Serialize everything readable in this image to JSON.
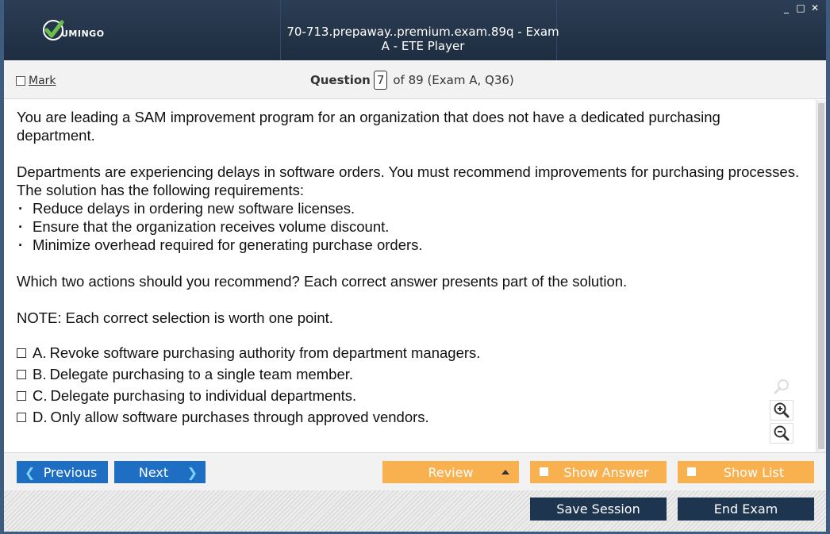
{
  "window": {
    "title": "70-713.prepaway..premium.exam.89q - Exam A - ETE Player",
    "logo_text": "UMINGO",
    "controls": {
      "minimize": "_",
      "maximize": "□",
      "close": "✕"
    }
  },
  "header": {
    "mark_label": "Mark",
    "question_label": "Question",
    "question_number": "7",
    "question_of": "of 89 (Exam A, Q36)"
  },
  "question": {
    "intro": "You are leading a SAM improvement program for an organization that does not have a dedicated purchasing department.",
    "scenario": "Departments are experiencing delays in software orders. You must recommend improvements for purchasing processes. The solution has the following requirements:",
    "requirements": [
      "Reduce delays in ordering new software licenses.",
      "Ensure that the organization receives volume discount.",
      "Minimize overhead required for generating purchase orders."
    ],
    "prompt": "Which two actions should you recommend? Each correct answer presents part of the solution.",
    "note": "NOTE: Each correct selection is worth one point.",
    "answers": [
      {
        "letter": "A.",
        "text": "Revoke software purchasing authority from department managers."
      },
      {
        "letter": "B.",
        "text": "Delegate purchasing to a single team member."
      },
      {
        "letter": "C.",
        "text": "Delegate purchasing to individual departments."
      },
      {
        "letter": "D.",
        "text": "Only allow software purchases through approved vendors."
      }
    ]
  },
  "zoom": {
    "icons": [
      "search-icon",
      "zoom-in-icon",
      "zoom-out-icon"
    ]
  },
  "nav": {
    "previous": "Previous",
    "next": "Next",
    "review": "Review",
    "show_answer": "Show Answer",
    "show_list": "Show List",
    "save_session": "Save Session",
    "end_exam": "End Exam"
  },
  "colors": {
    "titlebar": "#1e2d40",
    "primary_button": "#1e6fc4",
    "secondary_button": "#f9b04f",
    "dark_button": "#1e3550",
    "logo_check": "#6cc04a"
  }
}
